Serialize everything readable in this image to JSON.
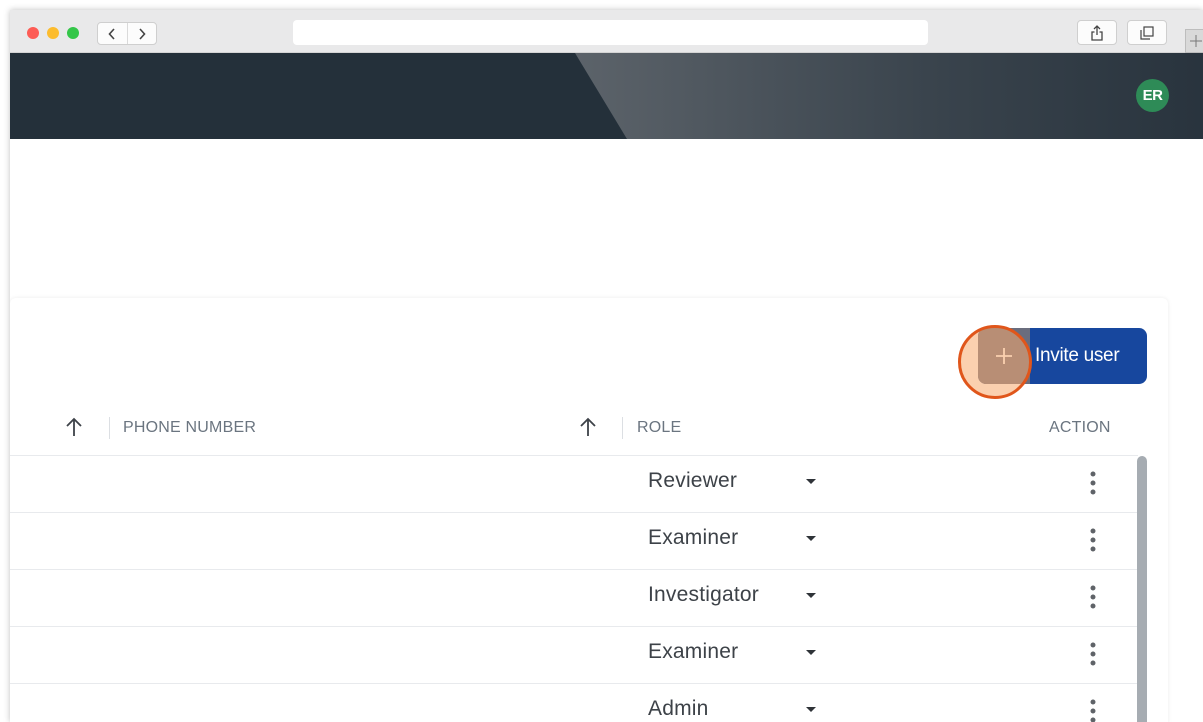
{
  "browser": {
    "url": "",
    "back_icon": "chevron-left-icon",
    "forward_icon": "chevron-right-icon",
    "share_icon": "share-icon",
    "tabs_icon": "tabs-icon",
    "new_tab_icon": "plus-icon"
  },
  "header": {
    "avatar_initials": "ER",
    "avatar_color": "#2e8b57",
    "background_color": "#24303a"
  },
  "toolbar": {
    "invite_label": "Invite user",
    "invite_icon": "plus-icon",
    "invite_color": "#17479e"
  },
  "table": {
    "columns": {
      "phone": "PHONE NUMBER",
      "role": "ROLE",
      "action": "ACTION"
    },
    "rows": [
      {
        "role": "Reviewer"
      },
      {
        "role": "Examiner"
      },
      {
        "role": "Investigator"
      },
      {
        "role": "Examiner"
      },
      {
        "role": "Admin"
      }
    ]
  },
  "colors": {
    "highlight_ring": "#e0561b",
    "scrollbar": "#a6acb2"
  }
}
